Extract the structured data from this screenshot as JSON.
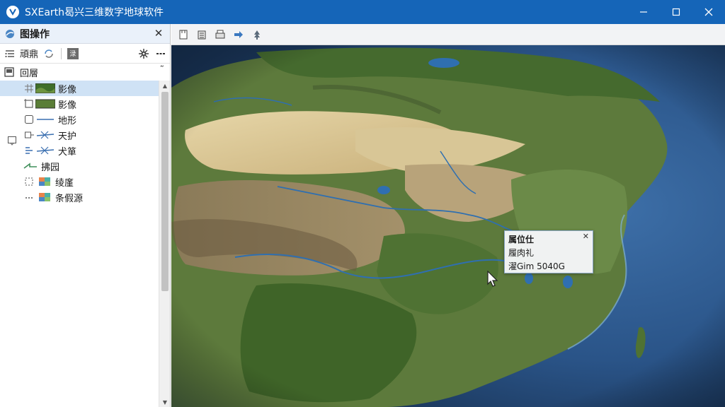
{
  "window": {
    "title": "SXEarth曷兴三维数字地球软件"
  },
  "panel": {
    "title": "图操作",
    "toolbar_label": "頑鼎",
    "toolbar_box": "渌",
    "layers_header": "回層"
  },
  "layers": [
    {
      "label": "影像",
      "selected": true
    },
    {
      "label": "影像",
      "selected": false
    },
    {
      "label": "地形",
      "selected": false
    },
    {
      "label": "天护",
      "selected": false
    },
    {
      "label": "犬箪",
      "selected": false
    },
    {
      "label": "拂园",
      "selected": false
    },
    {
      "label": "绫廑",
      "selected": false
    },
    {
      "label": "条假源",
      "selected": false
    }
  ],
  "popup": {
    "title": "属位仕",
    "line1": "履肉礼",
    "line2": "濯Gim 5040G"
  },
  "colors": {
    "titlebar": "#1565b8",
    "selected_row": "#cfe2f5",
    "panel_header": "#eaf1fa"
  },
  "icons": {
    "app": "app-logo-icon",
    "minimize": "minimize-icon",
    "maximize": "maximize-icon",
    "close": "close-icon",
    "map_toolbar": [
      "open-file-icon",
      "save-icon",
      "print-icon",
      "arrow-right-icon",
      "tree-icon"
    ]
  }
}
